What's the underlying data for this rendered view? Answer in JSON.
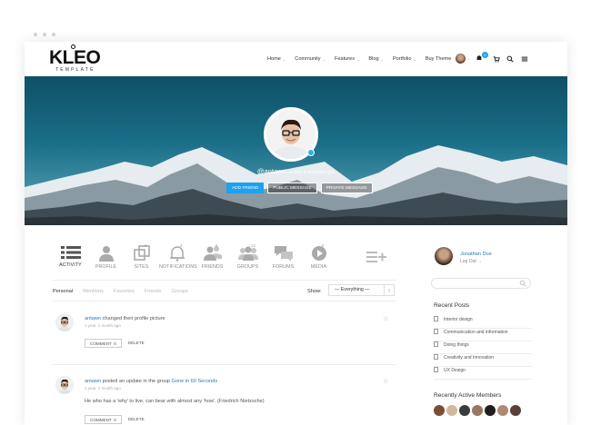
{
  "brand": {
    "name": "KLEO",
    "tagline": "TEMPLATE"
  },
  "nav": {
    "items": [
      {
        "label": "Home",
        "dropdown": true
      },
      {
        "label": "Community",
        "dropdown": true
      },
      {
        "label": "Features",
        "dropdown": true
      },
      {
        "label": "Blog",
        "dropdown": true
      },
      {
        "label": "Portfolio",
        "dropdown": true
      },
      {
        "label": "Buy Theme",
        "dropdown": false
      }
    ],
    "notification_count": "0",
    "icons": [
      "user-avatar",
      "bell-icon",
      "cart-icon",
      "search-icon",
      "menu-icon"
    ]
  },
  "profile": {
    "handle": "@antawn",
    "active_text": "active 4 minutes ago",
    "buttons": {
      "add_friend": "ADD FRIEND",
      "public_message": "PUBLIC MESSAGE",
      "private_message": "PRIVATE MESSAGE"
    }
  },
  "tabs": [
    {
      "label": "ACTIVITY",
      "icon": "list-icon",
      "badge": ""
    },
    {
      "label": "PROFILE",
      "icon": "user-icon",
      "badge": ""
    },
    {
      "label": "SITES",
      "icon": "sites-icon",
      "badge": "0"
    },
    {
      "label": "NOTIFICATIONS",
      "icon": "bell-icon",
      "badge": "4"
    },
    {
      "label": "FRIENDS",
      "icon": "friends-icon",
      "badge": "6"
    },
    {
      "label": "GROUPS",
      "icon": "groups-icon",
      "badge": "12"
    },
    {
      "label": "FORUMS",
      "icon": "forums-icon",
      "badge": ""
    },
    {
      "label": "MEDIA",
      "icon": "media-icon",
      "badge": "0"
    }
  ],
  "subnav": {
    "items": [
      "Personal",
      "Mentions",
      "Favorites",
      "Friends",
      "Groups"
    ],
    "current": "Personal",
    "show_label": "Show:",
    "show_value": "— Everything —"
  },
  "activity": [
    {
      "user": "antawn",
      "action": "changed their profile picture",
      "link": "",
      "time": "1 year, 1 month ago",
      "quote": "",
      "comment_label": "COMMENT",
      "comment_count": "0",
      "delete_label": "DELETE"
    },
    {
      "user": "antawn",
      "action": "posted an update in the group",
      "link": "Gone in 60 Seconds",
      "time": "1 year, 1 month ago",
      "quote": "He who has a 'why' to live, can bear with almost any 'how'. (Friedrich Nietzsche)",
      "comment_label": "COMMENT",
      "comment_count": "0",
      "delete_label": "DELETE"
    }
  ],
  "sidebar": {
    "user_name": "Jonathan Doe",
    "logout_label": "Log Out →",
    "recent_posts_title": "Recent Posts",
    "recent_posts": [
      "Interior design",
      "Communication and information",
      "Doing things",
      "Creativity and Innovation",
      "UX Design"
    ],
    "members_title": "Recently Active Members",
    "member_colors": [
      "#7a4e36",
      "#d2b79b",
      "#3b3b3b",
      "#9b7760",
      "#1f1f1f",
      "#b08a70",
      "#5a3f33"
    ]
  },
  "colors": {
    "accent": "#1da1f2",
    "link": "#2a7ab8",
    "hero_top": "#0f4f66"
  }
}
